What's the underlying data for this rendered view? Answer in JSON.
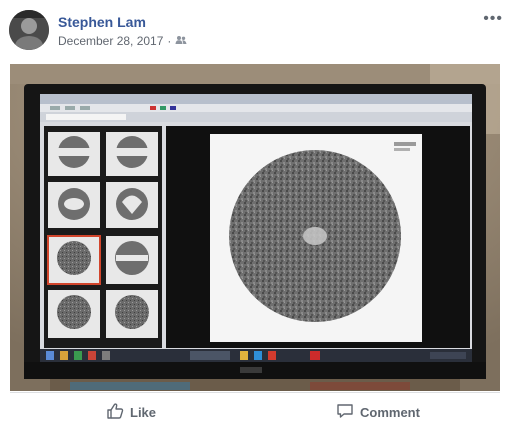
{
  "post": {
    "author": "Stephen Lam",
    "date": "December 28, 2017",
    "separator": "·",
    "audience_icon": "friends-icon",
    "more_icon": "more-options-icon",
    "more_label": "•••"
  },
  "actions": {
    "like_label": "Like",
    "comment_label": "Comment"
  },
  "photo": {
    "description_icon": "monitor-photo"
  },
  "colors": {
    "author_link": "#385898",
    "meta_text": "#616770",
    "action_text": "#606770"
  }
}
